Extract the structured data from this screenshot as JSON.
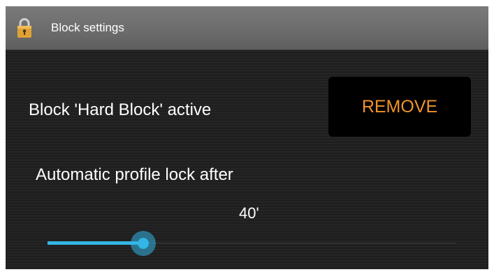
{
  "titlebar": {
    "icon": "lock-icon",
    "title": "Block settings"
  },
  "block": {
    "status_text": "Block 'Hard Block' active",
    "remove_label": "REMOVE",
    "accent_color": "#f0942b"
  },
  "auto_lock": {
    "label": "Automatic profile lock after",
    "value_text": "40'",
    "slider_fraction": 0.235,
    "slider_color": "#33b5e5"
  }
}
